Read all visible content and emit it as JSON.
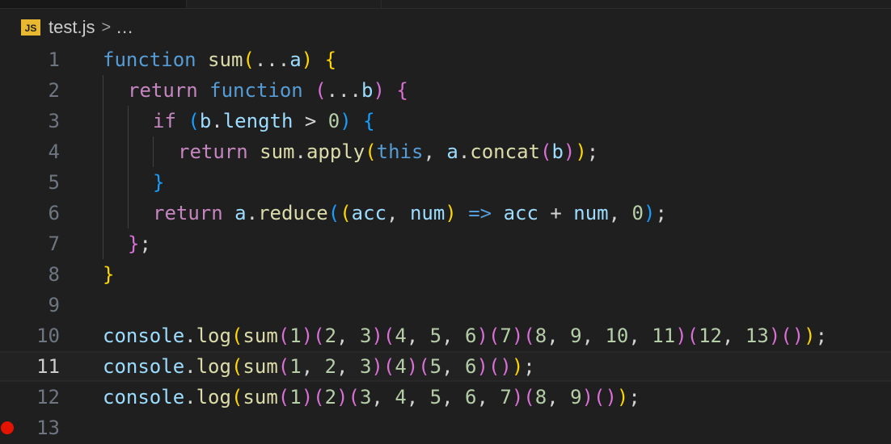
{
  "breadcrumb": {
    "file_icon": "JS",
    "file_name": "test.js",
    "separator": ">",
    "ellipsis": "…"
  },
  "editor": {
    "current_line": 11,
    "breakpoint_line": 13,
    "lines": [
      {
        "number": "1",
        "tokens": [
          [
            "kw",
            "function"
          ],
          [
            "pun",
            " "
          ],
          [
            "fn",
            "sum"
          ],
          [
            "b1",
            "("
          ],
          [
            "pun",
            "..."
          ],
          [
            "var",
            "a"
          ],
          [
            "b1",
            ")"
          ],
          [
            "pun",
            " "
          ],
          [
            "b1",
            "{"
          ]
        ]
      },
      {
        "number": "2",
        "tokens": [
          [
            "ctl",
            "return"
          ],
          [
            "pun",
            " "
          ],
          [
            "kw",
            "function"
          ],
          [
            "pun",
            " "
          ],
          [
            "b2",
            "("
          ],
          [
            "pun",
            "..."
          ],
          [
            "var",
            "b"
          ],
          [
            "b2",
            ")"
          ],
          [
            "pun",
            " "
          ],
          [
            "b2",
            "{"
          ]
        ]
      },
      {
        "number": "3",
        "tokens": [
          [
            "ctl",
            "if"
          ],
          [
            "pun",
            " "
          ],
          [
            "b3",
            "("
          ],
          [
            "var",
            "b"
          ],
          [
            "pun",
            "."
          ],
          [
            "var",
            "length"
          ],
          [
            "pun",
            " > "
          ],
          [
            "num",
            "0"
          ],
          [
            "b3",
            ")"
          ],
          [
            "pun",
            " "
          ],
          [
            "b3",
            "{"
          ]
        ]
      },
      {
        "number": "4",
        "tokens": [
          [
            "ctl",
            "return"
          ],
          [
            "pun",
            " "
          ],
          [
            "fn",
            "sum"
          ],
          [
            "pun",
            "."
          ],
          [
            "fn",
            "apply"
          ],
          [
            "b1",
            "("
          ],
          [
            "kw",
            "this"
          ],
          [
            "pun",
            ", "
          ],
          [
            "var",
            "a"
          ],
          [
            "pun",
            "."
          ],
          [
            "fn",
            "concat"
          ],
          [
            "b2",
            "("
          ],
          [
            "var",
            "b"
          ],
          [
            "b2",
            ")"
          ],
          [
            "b1",
            ")"
          ],
          [
            "pun",
            ";"
          ]
        ]
      },
      {
        "number": "5",
        "tokens": [
          [
            "b3",
            "}"
          ]
        ]
      },
      {
        "number": "6",
        "tokens": [
          [
            "ctl",
            "return"
          ],
          [
            "pun",
            " "
          ],
          [
            "var",
            "a"
          ],
          [
            "pun",
            "."
          ],
          [
            "fn",
            "reduce"
          ],
          [
            "b3",
            "("
          ],
          [
            "b1",
            "("
          ],
          [
            "var",
            "acc"
          ],
          [
            "pun",
            ", "
          ],
          [
            "var",
            "num"
          ],
          [
            "b1",
            ")"
          ],
          [
            "pun",
            " "
          ],
          [
            "kw",
            "=>"
          ],
          [
            "pun",
            " "
          ],
          [
            "var",
            "acc"
          ],
          [
            "pun",
            " + "
          ],
          [
            "var",
            "num"
          ],
          [
            "pun",
            ", "
          ],
          [
            "num",
            "0"
          ],
          [
            "b3",
            ")"
          ],
          [
            "pun",
            ";"
          ]
        ]
      },
      {
        "number": "7",
        "tokens": [
          [
            "b2",
            "}"
          ],
          [
            "pun",
            ";"
          ]
        ]
      },
      {
        "number": "8",
        "tokens": [
          [
            "b1",
            "}"
          ]
        ]
      },
      {
        "number": "9",
        "tokens": []
      },
      {
        "number": "10",
        "tokens": [
          [
            "var",
            "console"
          ],
          [
            "pun",
            "."
          ],
          [
            "fn",
            "log"
          ],
          [
            "b1",
            "("
          ],
          [
            "fn",
            "sum"
          ],
          [
            "b2",
            "("
          ],
          [
            "num",
            "1"
          ],
          [
            "b2",
            ")"
          ],
          [
            "b2",
            "("
          ],
          [
            "num",
            "2"
          ],
          [
            "pun",
            ", "
          ],
          [
            "num",
            "3"
          ],
          [
            "b2",
            ")"
          ],
          [
            "b2",
            "("
          ],
          [
            "num",
            "4"
          ],
          [
            "pun",
            ", "
          ],
          [
            "num",
            "5"
          ],
          [
            "pun",
            ", "
          ],
          [
            "num",
            "6"
          ],
          [
            "b2",
            ")"
          ],
          [
            "b2",
            "("
          ],
          [
            "num",
            "7"
          ],
          [
            "b2",
            ")"
          ],
          [
            "b2",
            "("
          ],
          [
            "num",
            "8"
          ],
          [
            "pun",
            ", "
          ],
          [
            "num",
            "9"
          ],
          [
            "pun",
            ", "
          ],
          [
            "num",
            "10"
          ],
          [
            "pun",
            ", "
          ],
          [
            "num",
            "11"
          ],
          [
            "b2",
            ")"
          ],
          [
            "b2",
            "("
          ],
          [
            "num",
            "12"
          ],
          [
            "pun",
            ", "
          ],
          [
            "num",
            "13"
          ],
          [
            "b2",
            ")"
          ],
          [
            "b2",
            "()"
          ],
          [
            "b1",
            ")"
          ],
          [
            "pun",
            ";"
          ]
        ]
      },
      {
        "number": "11",
        "tokens": [
          [
            "var",
            "console"
          ],
          [
            "pun",
            "."
          ],
          [
            "fn",
            "log"
          ],
          [
            "b1",
            "("
          ],
          [
            "fn",
            "sum"
          ],
          [
            "b2",
            "("
          ],
          [
            "num",
            "1"
          ],
          [
            "pun",
            ", "
          ],
          [
            "num",
            "2"
          ],
          [
            "pun",
            ", "
          ],
          [
            "num",
            "3"
          ],
          [
            "b2",
            ")"
          ],
          [
            "b2",
            "("
          ],
          [
            "num",
            "4"
          ],
          [
            "b2",
            ")"
          ],
          [
            "b2",
            "("
          ],
          [
            "num",
            "5"
          ],
          [
            "pun",
            ", "
          ],
          [
            "num",
            "6"
          ],
          [
            "b2",
            ")"
          ],
          [
            "b2",
            "()"
          ],
          [
            "b1",
            ")"
          ],
          [
            "pun",
            ";"
          ]
        ]
      },
      {
        "number": "12",
        "tokens": [
          [
            "var",
            "console"
          ],
          [
            "pun",
            "."
          ],
          [
            "fn",
            "log"
          ],
          [
            "b1",
            "("
          ],
          [
            "fn",
            "sum"
          ],
          [
            "b2",
            "("
          ],
          [
            "num",
            "1"
          ],
          [
            "b2",
            ")"
          ],
          [
            "b2",
            "("
          ],
          [
            "num",
            "2"
          ],
          [
            "b2",
            ")"
          ],
          [
            "b2",
            "("
          ],
          [
            "num",
            "3"
          ],
          [
            "pun",
            ", "
          ],
          [
            "num",
            "4"
          ],
          [
            "pun",
            ", "
          ],
          [
            "num",
            "5"
          ],
          [
            "pun",
            ", "
          ],
          [
            "num",
            "6"
          ],
          [
            "pun",
            ", "
          ],
          [
            "num",
            "7"
          ],
          [
            "b2",
            ")"
          ],
          [
            "b2",
            "("
          ],
          [
            "num",
            "8"
          ],
          [
            "pun",
            ", "
          ],
          [
            "num",
            "9"
          ],
          [
            "b2",
            ")"
          ],
          [
            "b2",
            "()"
          ],
          [
            "b1",
            ")"
          ],
          [
            "pun",
            ";"
          ]
        ]
      },
      {
        "number": "13",
        "tokens": []
      }
    ]
  },
  "colors": {
    "background": "#1f1f1f",
    "keyword": "#569cd6",
    "control": "#c586c0",
    "function": "#dcdcaa",
    "variable": "#9cdcfe",
    "number": "#b5cea8",
    "bracket_level1": "#ffd700",
    "bracket_level2": "#da70d6",
    "bracket_level3": "#179fff",
    "breakpoint": "#e51400"
  }
}
